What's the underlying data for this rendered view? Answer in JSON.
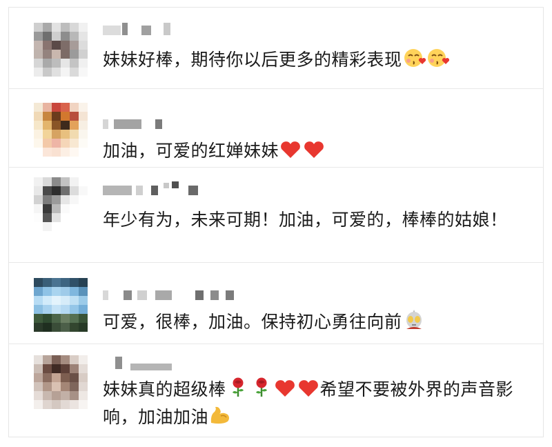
{
  "comments": [
    {
      "text": "妹妹好棒，期待你以后更多的精彩表现",
      "emoji": [
        "blush-kiss-face-icon",
        "blush-kiss-face-icon"
      ]
    },
    {
      "text": "加油，可爱的红婵妹妹",
      "emoji": [
        "red-heart-icon",
        "red-heart-icon"
      ]
    },
    {
      "text": "年少有为，未来可期！加油，可爱的，棒棒的姑娘！",
      "emoji": []
    },
    {
      "text": "可爱，很棒，加油。保持初心勇往向前",
      "emoji": [
        "ultraman-icon"
      ]
    },
    {
      "text": "妹妹真的超级棒",
      "emoji": [
        "rose-icon",
        "rose-icon",
        "red-heart-icon",
        "red-heart-icon"
      ],
      "text2": "希望不要被外界的声音影响，加油加油",
      "emoji2": [
        "flexed-biceps-icon"
      ]
    }
  ],
  "colors": {
    "text": "#1a1a1a",
    "separator": "#e8e8e8",
    "heart": "#e8372f",
    "face": "#ffd35a"
  }
}
